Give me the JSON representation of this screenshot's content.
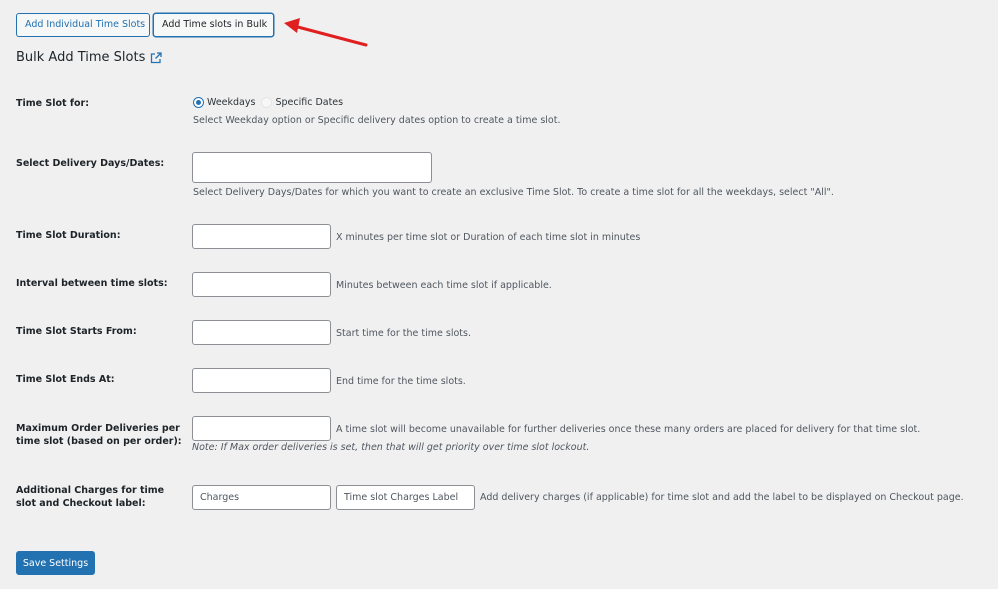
{
  "tabs": [
    {
      "label": "Add Individual Time Slots",
      "active": false
    },
    {
      "label": "Add Time slots in Bulk",
      "active": true
    }
  ],
  "annotation": {
    "type": "red-arrow",
    "color": "#e02020",
    "points_to": "Add Time slots in Bulk"
  },
  "section": {
    "title": "Bulk Add Time Slots",
    "title_icon": "external-link-icon"
  },
  "fields": {
    "time_slot_for": {
      "label": "Time Slot for:",
      "options": [
        {
          "label": "Weekdays",
          "checked": true
        },
        {
          "label": "Specific Dates",
          "checked": false
        }
      ],
      "description": "Select Weekday option or Specific delivery dates option to create a time slot."
    },
    "delivery_days": {
      "label": "Select Delivery Days/Dates:",
      "value": "",
      "description": "Select Delivery Days/Dates for which you want to create an exclusive Time Slot. To create a time slot for all the weekdays, select \"All\"."
    },
    "duration": {
      "label": "Time Slot Duration:",
      "value": "",
      "description": "X minutes per time slot or Duration of each time slot in minutes"
    },
    "interval": {
      "label": "Interval between time slots:",
      "value": "",
      "description": "Minutes between each time slot if applicable."
    },
    "starts_from": {
      "label": "Time Slot Starts From:",
      "value": "",
      "description": "Start time for the time slots."
    },
    "ends_at": {
      "label": "Time Slot Ends At:",
      "value": "",
      "description": "End time for the time slots."
    },
    "max_orders": {
      "label_line1": "Maximum Order Deliveries per",
      "label_line2": "time slot (based on per order):",
      "value": "",
      "description": "A time slot will become unavailable for further deliveries once these many orders are placed for delivery for that time slot.",
      "note": "Note: If Max order deliveries is set, then that will get priority over time slot lockout."
    },
    "additional_charges": {
      "label_line1": "Additional Charges for time",
      "label_line2": "slot and Checkout label:",
      "charges_placeholder": "Charges",
      "label_placeholder": "Time slot Charges Label",
      "description": "Add delivery charges (if applicable) for time slot and add the label to be displayed on Checkout page."
    }
  },
  "save_button": {
    "label": "Save Settings"
  },
  "colors": {
    "accent": "#2271b1",
    "background": "#f0f0f1",
    "arrow": "#e02020"
  }
}
